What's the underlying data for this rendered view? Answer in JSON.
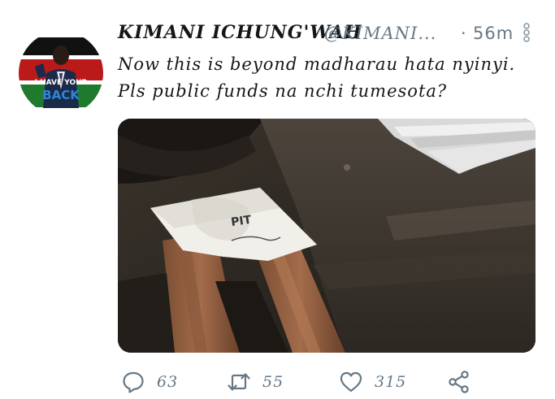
{
  "tweet": {
    "display_name": "KIMANI ICHUNG'WAH",
    "handle": "@KIMANI...",
    "separator": "·",
    "time": "56m",
    "text": "Now this is beyond madharau hata nyinyi. Pls public funds na nchi tumesota?",
    "avatar": {
      "text_line1": "I HAVE YOUR",
      "text_line2": "BACK",
      "flag_colors": [
        "#000000",
        "#bb0000",
        "#006600",
        "#ffffff"
      ]
    },
    "media": {
      "document_text": "PIT"
    }
  },
  "actions": {
    "reply_count": "63",
    "retweet_count": "55",
    "like_count": "315"
  },
  "colors": {
    "text": "#14171a",
    "secondary": "#657786",
    "icon": "#657786"
  },
  "icons": {
    "reply": "reply-icon",
    "retweet": "retweet-icon",
    "like": "heart-icon",
    "share": "share-icon",
    "more": "more-vertical-icon"
  }
}
